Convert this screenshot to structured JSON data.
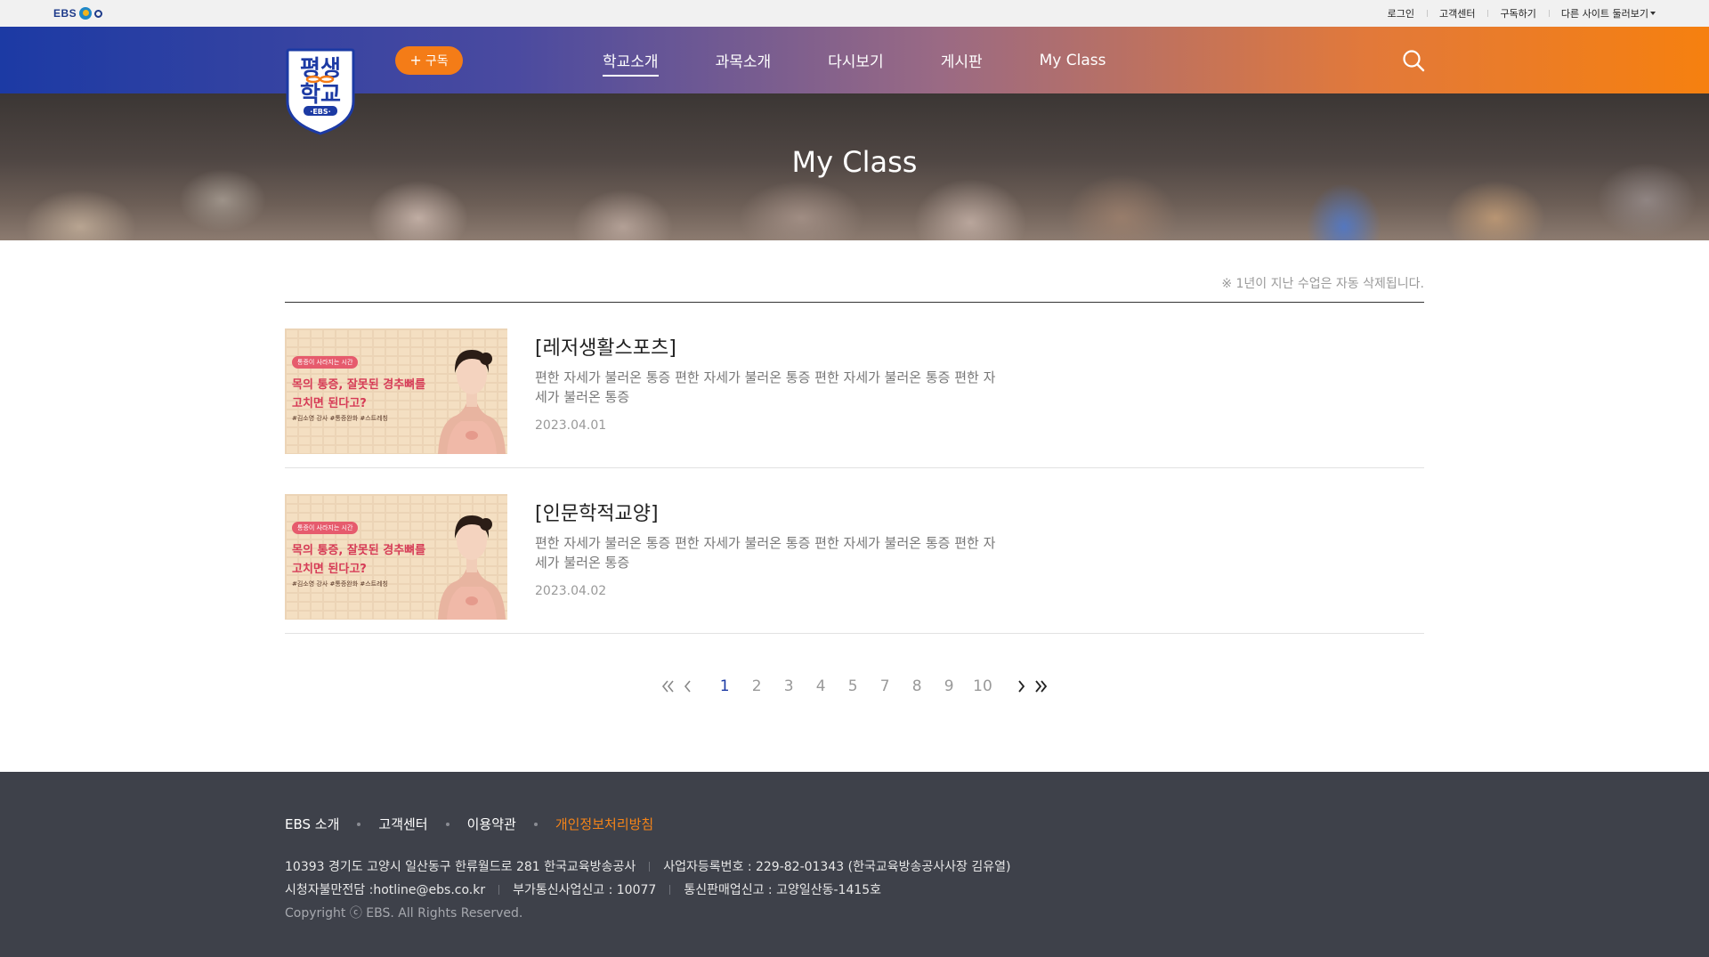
{
  "utilbar": {
    "logo_text": "EBS",
    "links": [
      "로그인",
      "고객센터",
      "구독하기",
      "다른 사이트 둘러보기"
    ]
  },
  "header": {
    "school_logo": {
      "line1": "평생",
      "line2": "학교",
      "badge": "·EBS·"
    },
    "subscribe_label": "구독",
    "nav": [
      "학교소개",
      "과목소개",
      "다시보기",
      "게시판",
      "My Class"
    ],
    "active_nav": "학교소개"
  },
  "hero": {
    "title": "My Class"
  },
  "notice": "※ 1년이 지난 수업은 자동 삭제됩니다.",
  "classes": [
    {
      "title": "[레저생활스포츠]",
      "description": "편한 자세가 불러온 통증 편한 자세가 불러온 통증 편한 자세가 불러온 통증 편한 자세가 불러온 통증",
      "date": "2023.04.01",
      "thumbnail": {
        "badge": "통증이 사라지는 시간",
        "line1": "목의 통증, 잘못된 경추뼈를",
        "line2": "고치면 된다고?",
        "tags": "#김소영 강사 #통증완화 #스트레칭"
      }
    },
    {
      "title": "[인문학적교양]",
      "description": "편한 자세가 불러온 통증 편한 자세가 불러온 통증 편한 자세가 불러온 통증 편한 자세가 불러온 통증",
      "date": "2023.04.02",
      "thumbnail": {
        "badge": "통증이 사라지는 시간",
        "line1": "목의 통증, 잘못된 경추뼈를",
        "line2": "고치면 된다고?",
        "tags": "#김소영 강사 #통증완화 #스트레칭"
      }
    }
  ],
  "pagination": {
    "pages": [
      "1",
      "2",
      "3",
      "4",
      "5",
      "7",
      "8",
      "9",
      "10"
    ],
    "current": "1"
  },
  "footer": {
    "links": [
      "EBS 소개",
      "고객센터",
      "이용약관",
      "개인정보처리방침"
    ],
    "address": "10393 경기도 고양시 일산동구 한류월드로 281 한국교육방송공사",
    "business_no": "사업자등록번호 : 229-82-01343 (한국교육방송공사사장 김유열)",
    "hotline": "시청자불만전담 :hotline@ebs.co.kr",
    "vas_report": "부가통신사업신고 : 10077",
    "ecommerce_report": "통신판매업신고 : 고양일산동-1415호",
    "copyright": "Copyright ⓒ EBS. All Rights Reserved."
  },
  "colors": {
    "brand_blue": "#1c3aa4",
    "brand_orange": "#f6800f",
    "footer_bg": "#3e414a"
  }
}
